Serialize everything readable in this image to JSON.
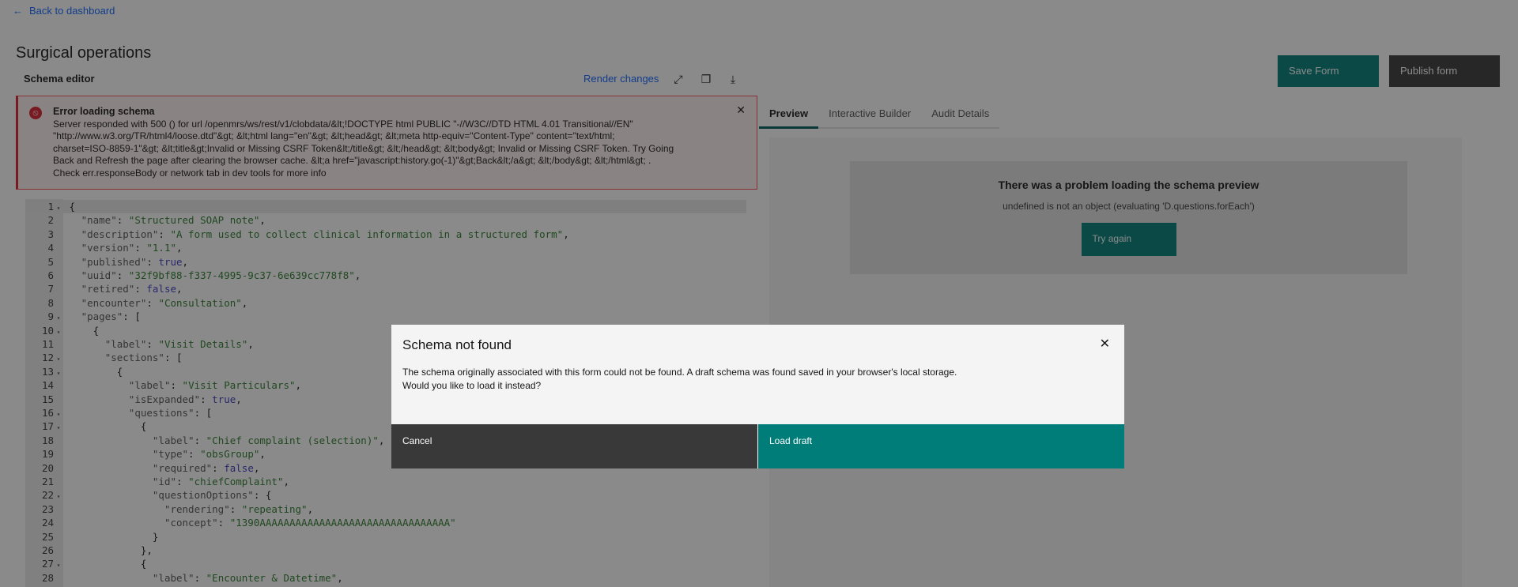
{
  "nav": {
    "back_label": "Back to dashboard"
  },
  "page_title": "Surgical operations",
  "editor": {
    "title": "Schema editor",
    "render_label": "Render changes",
    "icons": [
      "maximize-icon",
      "copy-icon",
      "download-icon"
    ],
    "error": {
      "title": "Error loading schema",
      "lines": [
        "Server responded with 500 () for url /openmrs/ws/rest/v1/clobdata/&lt;!DOCTYPE html PUBLIC \"-//W3C//DTD HTML 4.01 Transitional//EN\"",
        "\"http://www.w3.org/TR/html4/loose.dtd\"&gt; &lt;html lang=\"en\"&gt; &lt;head&gt; &lt;meta http-equiv=\"Content-Type\" content=\"text/html;",
        "charset=ISO-8859-1\"&gt; &lt;title&gt;Invalid or Missing CSRF Token&lt;/title&gt; &lt;/head&gt; &lt;body&gt; Invalid or Missing CSRF Token. Try Going",
        "Back and Refresh the page after clearing the browser cache. &lt;a href=\"javascript:history.go(-1)\"&gt;Back&lt;/a&gt; &lt;/body&gt; &lt;/html&gt; .",
        "Check err.responseBody or network tab in dev tools for more info"
      ]
    },
    "code": [
      {
        "n": "1",
        "fold": true,
        "t": "{"
      },
      {
        "n": "2",
        "t": "  \"name\": \"Structured SOAP note\","
      },
      {
        "n": "3",
        "t": "  \"description\": \"A form used to collect clinical information in a structured form\","
      },
      {
        "n": "4",
        "t": "  \"version\": \"1.1\","
      },
      {
        "n": "5",
        "t": "  \"published\": true,"
      },
      {
        "n": "6",
        "t": "  \"uuid\": \"32f9bf88-f337-4995-9c37-6e639cc778f8\","
      },
      {
        "n": "7",
        "t": "  \"retired\": false,"
      },
      {
        "n": "8",
        "t": "  \"encounter\": \"Consultation\","
      },
      {
        "n": "9",
        "fold": true,
        "t": "  \"pages\": ["
      },
      {
        "n": "10",
        "fold": true,
        "t": "    {"
      },
      {
        "n": "11",
        "t": "      \"label\": \"Visit Details\","
      },
      {
        "n": "12",
        "fold": true,
        "t": "      \"sections\": ["
      },
      {
        "n": "13",
        "fold": true,
        "t": "        {"
      },
      {
        "n": "14",
        "t": "          \"label\": \"Visit Particulars\","
      },
      {
        "n": "15",
        "t": "          \"isExpanded\": true,"
      },
      {
        "n": "16",
        "fold": true,
        "t": "          \"questions\": ["
      },
      {
        "n": "17",
        "fold": true,
        "t": "            {"
      },
      {
        "n": "18",
        "t": "              \"label\": \"Chief complaint (selection)\","
      },
      {
        "n": "19",
        "t": "              \"type\": \"obsGroup\","
      },
      {
        "n": "20",
        "t": "              \"required\": false,"
      },
      {
        "n": "21",
        "t": "              \"id\": \"chiefComplaint\","
      },
      {
        "n": "22",
        "fold": true,
        "t": "              \"questionOptions\": {"
      },
      {
        "n": "23",
        "t": "                \"rendering\": \"repeating\","
      },
      {
        "n": "24",
        "t": "                \"concept\": \"1390AAAAAAAAAAAAAAAAAAAAAAAAAAAAAAAA\""
      },
      {
        "n": "25",
        "t": "              }"
      },
      {
        "n": "26",
        "t": "            },"
      },
      {
        "n": "27",
        "fold": true,
        "t": "            {"
      },
      {
        "n": "28",
        "t": "              \"label\": \"Encounter & Datetime\","
      }
    ]
  },
  "header_actions": {
    "save_label": "Save Form",
    "publish_label": "Publish form"
  },
  "tabs": [
    {
      "label": "Preview",
      "selected": true
    },
    {
      "label": "Interactive Builder"
    },
    {
      "label": "Audit Details"
    }
  ],
  "preview_error": {
    "title": "There was a problem loading the schema preview",
    "message": "undefined is not an object (evaluating 'D.questions.forEach')",
    "retry_label": "Try again"
  },
  "modal": {
    "title": "Schema not found",
    "body_lines": [
      "The schema originally associated with this form could not be found. A draft schema was found saved in your browser's local storage.",
      "Would you like to load it instead?"
    ],
    "cancel_label": "Cancel",
    "confirm_label": "Load draft"
  },
  "colors": {
    "primary": "#007d79",
    "danger": "#da1e28",
    "link": "#0f62fe",
    "dark": "#393939"
  }
}
